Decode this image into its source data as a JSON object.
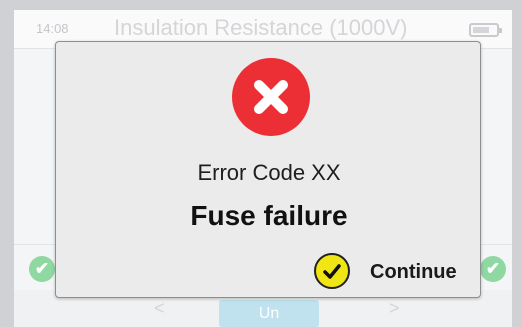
{
  "background": {
    "status_bar": {
      "time": "14:08",
      "title": "Insulation Resistance (1000V)",
      "battery_icon": "battery-icon"
    },
    "bottom_bar": {
      "prev_label": "<",
      "unit_button_label": "Un",
      "next_label": ">"
    },
    "check_icon": "check-circle-icon"
  },
  "dialog": {
    "icon": "error-x-icon",
    "error_code": "Error Code XX",
    "message": "Fuse failure",
    "continue_label": "Continue",
    "continue_icon": "check-icon"
  },
  "colors": {
    "error_red": "#ec2f35",
    "continue_yellow": "#f0e614",
    "dialog_bg": "#ebebeb",
    "success_green": "#8fd8a2",
    "unit_blue": "#bfe2ee"
  }
}
